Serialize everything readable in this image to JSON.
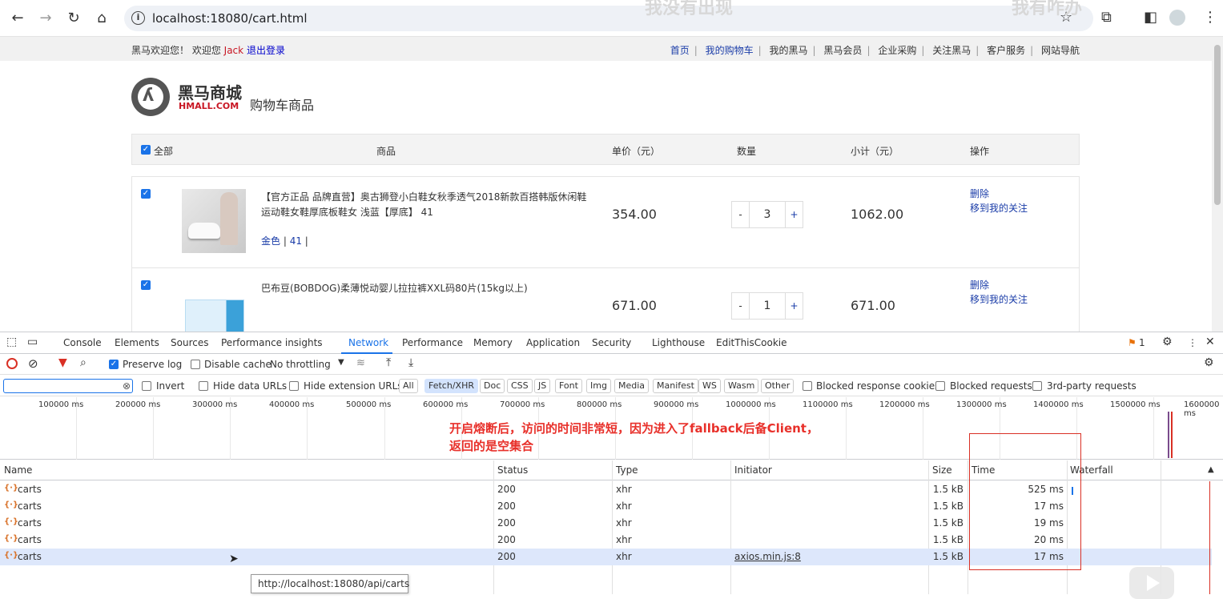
{
  "browser": {
    "url": "localhost:18080/cart.html",
    "ghost_text_1": "我没有出现",
    "ghost_text_2": "我有咋办"
  },
  "topbar": {
    "welcome_prefix": "黑马欢迎您！ 欢迎您",
    "username": "Jack",
    "logout": "退出登录",
    "nav": [
      "首页",
      "我的购物车",
      "我的黑马",
      "黑马会员",
      "企业采购",
      "关注黑马",
      "客户服务",
      "网站导航"
    ]
  },
  "header": {
    "brand_cn": "黑马商城",
    "brand_en": "HMALL.COM",
    "title": "购物车商品"
  },
  "cart": {
    "columns": {
      "select_all": "全部",
      "product": "商品",
      "unit_price": "单价（元）",
      "quantity": "数量",
      "subtotal": "小计（元）",
      "actions": "操作"
    },
    "items": [
      {
        "name": "【官方正品 品牌直营】奥古狮登小白鞋女秋季透气2018新款百搭韩版休闲鞋运动鞋女鞋厚底板鞋女 浅蓝【厚底】 41",
        "attr_color": "金色",
        "attr_size": "41",
        "price": "354.00",
        "qty": "3",
        "subtotal": "1062.00",
        "delete": "删除",
        "move": "移到我的关注"
      },
      {
        "name": "巴布豆(BOBDOG)柔薄悦动婴儿拉拉裤XXL码80片(15kg以上)",
        "price": "671.00",
        "qty": "1",
        "subtotal": "671.00",
        "delete": "删除",
        "move": "移到我的关注"
      }
    ],
    "qty_minus": "-",
    "qty_plus": "+"
  },
  "devtools": {
    "tabs": [
      "Console",
      "Elements",
      "Sources",
      "Performance insights",
      "Network",
      "Performance",
      "Memory",
      "Application",
      "Security",
      "Lighthouse",
      "EditThisCookie"
    ],
    "issues_count": "1",
    "toolbar": {
      "preserve_log": "Preserve log",
      "disable_cache": "Disable cache",
      "throttling": "No throttling"
    },
    "filterbar": {
      "invert": "Invert",
      "hide_data_urls": "Hide data URLs",
      "hide_extension_urls": "Hide extension URLs",
      "types": [
        "All",
        "Fetch/XHR",
        "Doc",
        "CSS",
        "JS",
        "Font",
        "Img",
        "Media",
        "Manifest",
        "WS",
        "Wasm",
        "Other"
      ],
      "blocked_cookies": "Blocked response cookies",
      "blocked_requests": "Blocked requests",
      "third_party": "3rd-party requests"
    },
    "timeline_ticks": [
      "100000 ms",
      "200000 ms",
      "300000 ms",
      "400000 ms",
      "500000 ms",
      "600000 ms",
      "700000 ms",
      "800000 ms",
      "900000 ms",
      "1000000 ms",
      "1100000 ms",
      "1200000 ms",
      "1300000 ms",
      "1400000 ms",
      "1500000 ms",
      "1600000 ms"
    ],
    "annotation_line1": "开启熔断后，访问的时间非常短，因为进入了fallback后备Client，",
    "annotation_line2": "返回的是空集合",
    "columns": {
      "name": "Name",
      "status": "Status",
      "type": "Type",
      "initiator": "Initiator",
      "size": "Size",
      "time": "Time",
      "waterfall": "Waterfall"
    },
    "requests": [
      {
        "name": "carts",
        "status": "200",
        "type": "xhr",
        "initiator": "",
        "size": "1.5 kB",
        "time": "525 ms"
      },
      {
        "name": "carts",
        "status": "200",
        "type": "xhr",
        "initiator": "",
        "size": "1.5 kB",
        "time": "17 ms"
      },
      {
        "name": "carts",
        "status": "200",
        "type": "xhr",
        "initiator": "",
        "size": "1.5 kB",
        "time": "19 ms"
      },
      {
        "name": "carts",
        "status": "200",
        "type": "xhr",
        "initiator": "",
        "size": "1.5 kB",
        "time": "20 ms"
      },
      {
        "name": "carts",
        "status": "200",
        "type": "xhr",
        "initiator": "axios.min.js:8",
        "size": "1.5 kB",
        "time": "17 ms"
      }
    ],
    "tooltip": "http://localhost:18080/api/carts"
  },
  "colors": {
    "accent": "#1a73e8",
    "annotation": "#e8302a",
    "username": "#c81623"
  }
}
